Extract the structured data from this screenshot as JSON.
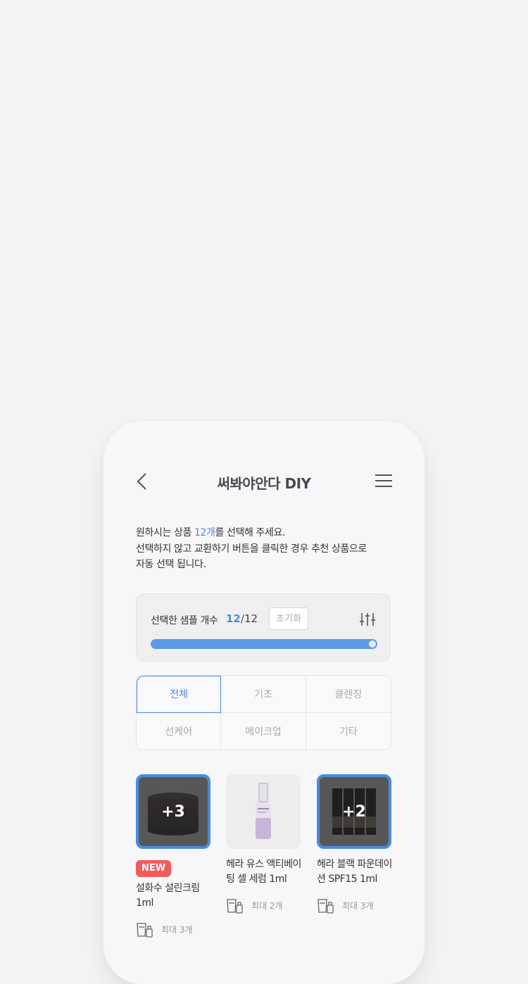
{
  "header": {
    "title": "써봐야안다 DIY"
  },
  "intro": {
    "line1_pre": "원하시는 상품 ",
    "line1_hl": "12개",
    "line1_post": "를 선택해 주세요.",
    "line2": "선택하지 않고 교환하기 버튼을 클릭한 경우 추천 상품으로",
    "line3": "자동 선택 됩니다."
  },
  "counter": {
    "label": "선택한 샘플 개수",
    "current": "12",
    "separator": "/",
    "max": "12",
    "reset_label": "초기화",
    "progress": 1.0,
    "accent": "#4a8cdc",
    "bar_color": "#5b9be6"
  },
  "tabs": [
    {
      "label": "전체",
      "active": true
    },
    {
      "label": "기초",
      "active": false
    },
    {
      "label": "클렌징",
      "active": false
    },
    {
      "label": "선케어",
      "active": false
    },
    {
      "label": "메이크업",
      "active": false
    },
    {
      "label": "기타",
      "active": false
    }
  ],
  "products": [
    {
      "name": "설화수 설린크림 1ml",
      "badge": "NEW",
      "selected": true,
      "overlay": "+3",
      "limit": "최대 3개"
    },
    {
      "name": "헤라 유스 액티베이팅 셀 세럼 1ml",
      "selected": false,
      "limit": "최대 2개"
    },
    {
      "name": "헤라 블랙 파운데이션 SPF15 1ml",
      "selected": true,
      "overlay": "+2",
      "limit": "최대 3개"
    }
  ],
  "colors": {
    "new_badge": "#f25c5c",
    "page_bg": "#f4f4f5"
  }
}
